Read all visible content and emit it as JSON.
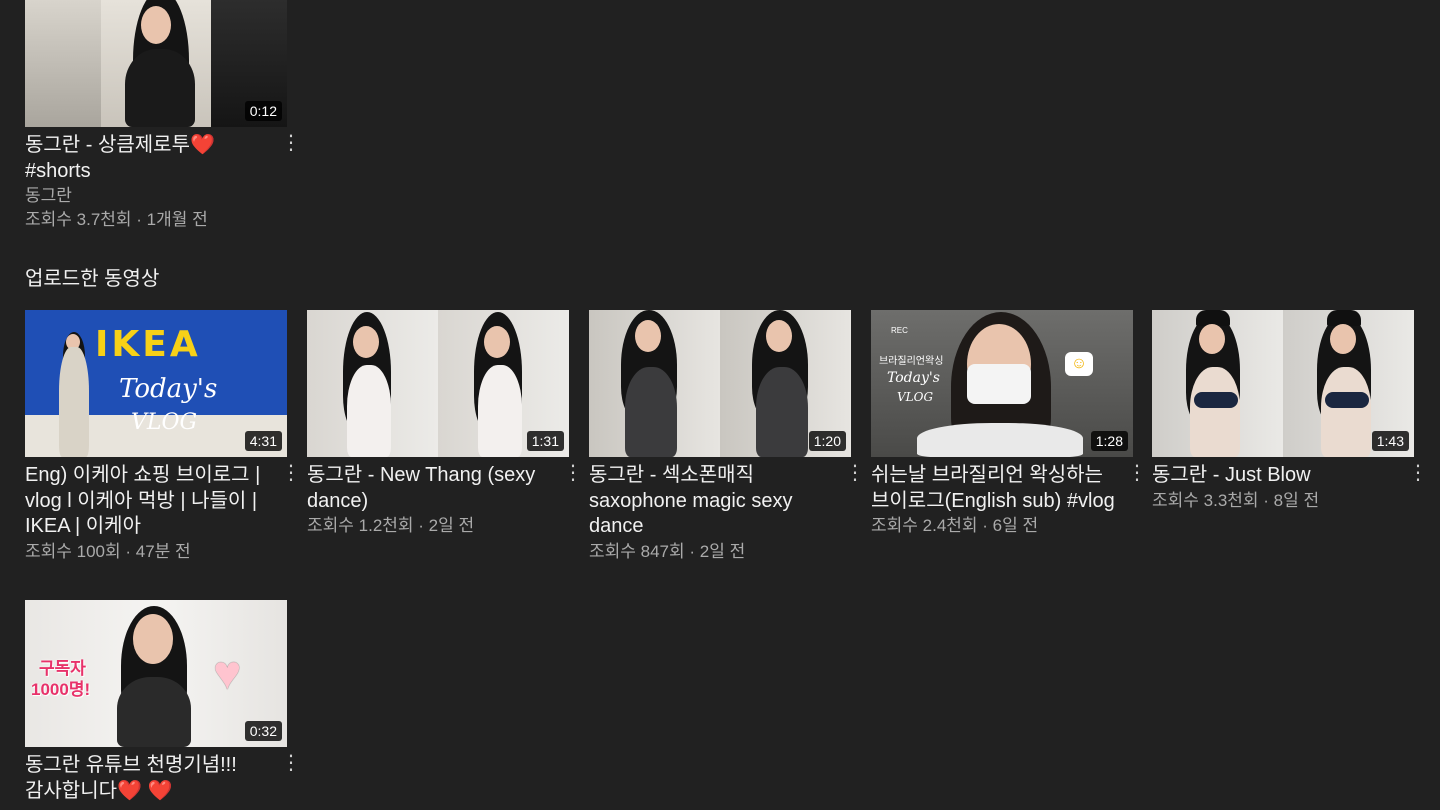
{
  "shorts_card": {
    "duration": "0:12",
    "title_line1": "동그란 - 상큼제로투",
    "title_line2": "#shorts",
    "channel": "동그란",
    "stats": "조회수 3.7천회 · 1개월 전"
  },
  "uploads_section": {
    "title": "업로드한 동영상",
    "videos": [
      {
        "duration": "4:31",
        "title": "Eng) 이케아 쇼핑 브이로그 | vlog l 이케아 먹방 | 나들이 | IKEA | 이케아",
        "stats": "조회수 100회 · 47분 전",
        "thumb_text_1": "IKEA",
        "thumb_text_2": "Today's",
        "thumb_text_3": "VLOG"
      },
      {
        "duration": "1:31",
        "title": "동그란 - New Thang (sexy dance)",
        "stats": "조회수 1.2천회 · 2일 전"
      },
      {
        "duration": "1:20",
        "title": "동그란 - 섹소폰매직 saxophone magic sexy dance",
        "stats": "조회수 847회 · 2일 전"
      },
      {
        "duration": "1:28",
        "title": "쉬는날 브라질리언 왁싱하는 브이로그(English sub) #vlog",
        "stats": "조회수 2.4천회 · 6일 전",
        "thumb_text_1": "브라질리언왁싱",
        "thumb_text_2": "Today's",
        "thumb_text_3": "VLOG",
        "rec_label": "REC"
      },
      {
        "duration": "1:43",
        "title": "동그란 - Just Blow",
        "stats": "조회수 3.3천회 · 8일 전"
      },
      {
        "duration": "0:32",
        "title": "동그란 유튜브 천명기념!!! 감사합니다",
        "stats": "",
        "thumb_text_1": "구독자",
        "thumb_text_2": "1000명!"
      }
    ]
  },
  "icons": {
    "more": "more-vert-icon",
    "heart": "heart-emoji-icon"
  },
  "colors": {
    "background": "#212121",
    "text_primary": "#f1f1f1",
    "text_secondary": "#aaaaaa",
    "ikea_blue": "#1f4fb5",
    "ikea_yellow": "#f7d117",
    "heart_red": "#e0245e"
  }
}
